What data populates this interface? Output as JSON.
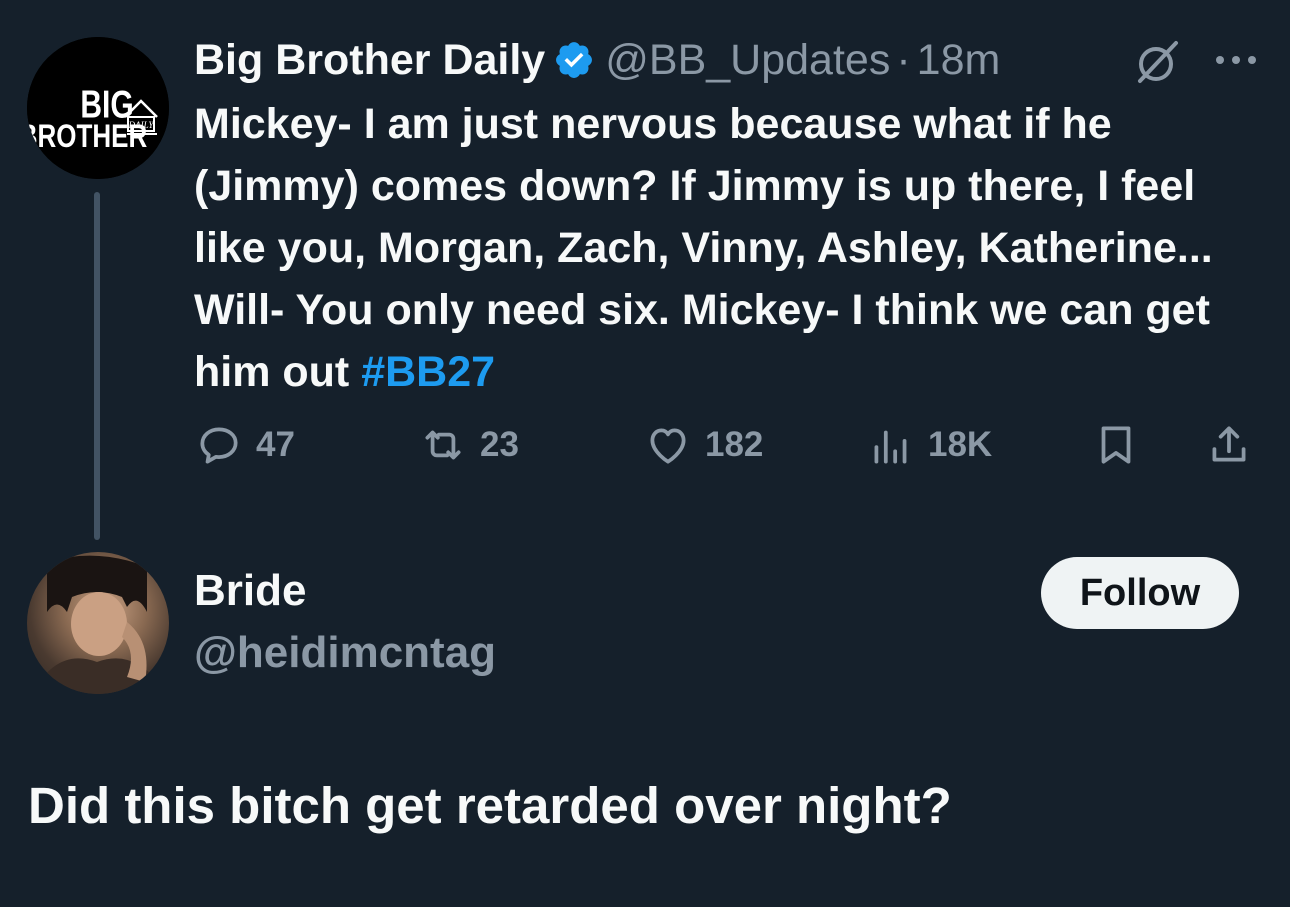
{
  "original_tweet": {
    "avatar": {
      "logo_line1": "BIG",
      "logo_line2": "BROTHER",
      "logo_tag": "DAILY"
    },
    "display_name": "Big Brother Daily",
    "handle": "@BB_Updates",
    "separator": "·",
    "time": "18m",
    "text": "Mickey- I am just nervous because what if he (Jimmy) comes down? If Jimmy is up there, I feel like you, Morgan, Zach, Vinny, Ashley, Katherine... Will- You only need six. Mickey- I think we can get him out ",
    "hashtag": "#BB27",
    "actions": {
      "replies": "47",
      "reposts": "23",
      "likes": "182",
      "views": "18K"
    },
    "icons": [
      "verified-badge-icon",
      "grok-icon",
      "more-icon",
      "reply-icon",
      "repost-icon",
      "like-icon",
      "views-icon",
      "bookmark-icon",
      "share-icon"
    ]
  },
  "reply": {
    "display_name": "Bride",
    "handle": "@heidimcntag",
    "follow_label": "Follow",
    "text": "Did this bitch get retarded over night?"
  },
  "colors": {
    "background": "#15202b",
    "primary_text": "#f7f9f9",
    "secondary_text": "#8b98a5",
    "accent": "#1d9bf0",
    "thread_line": "#425364",
    "follow_button": "#eff3f4"
  }
}
